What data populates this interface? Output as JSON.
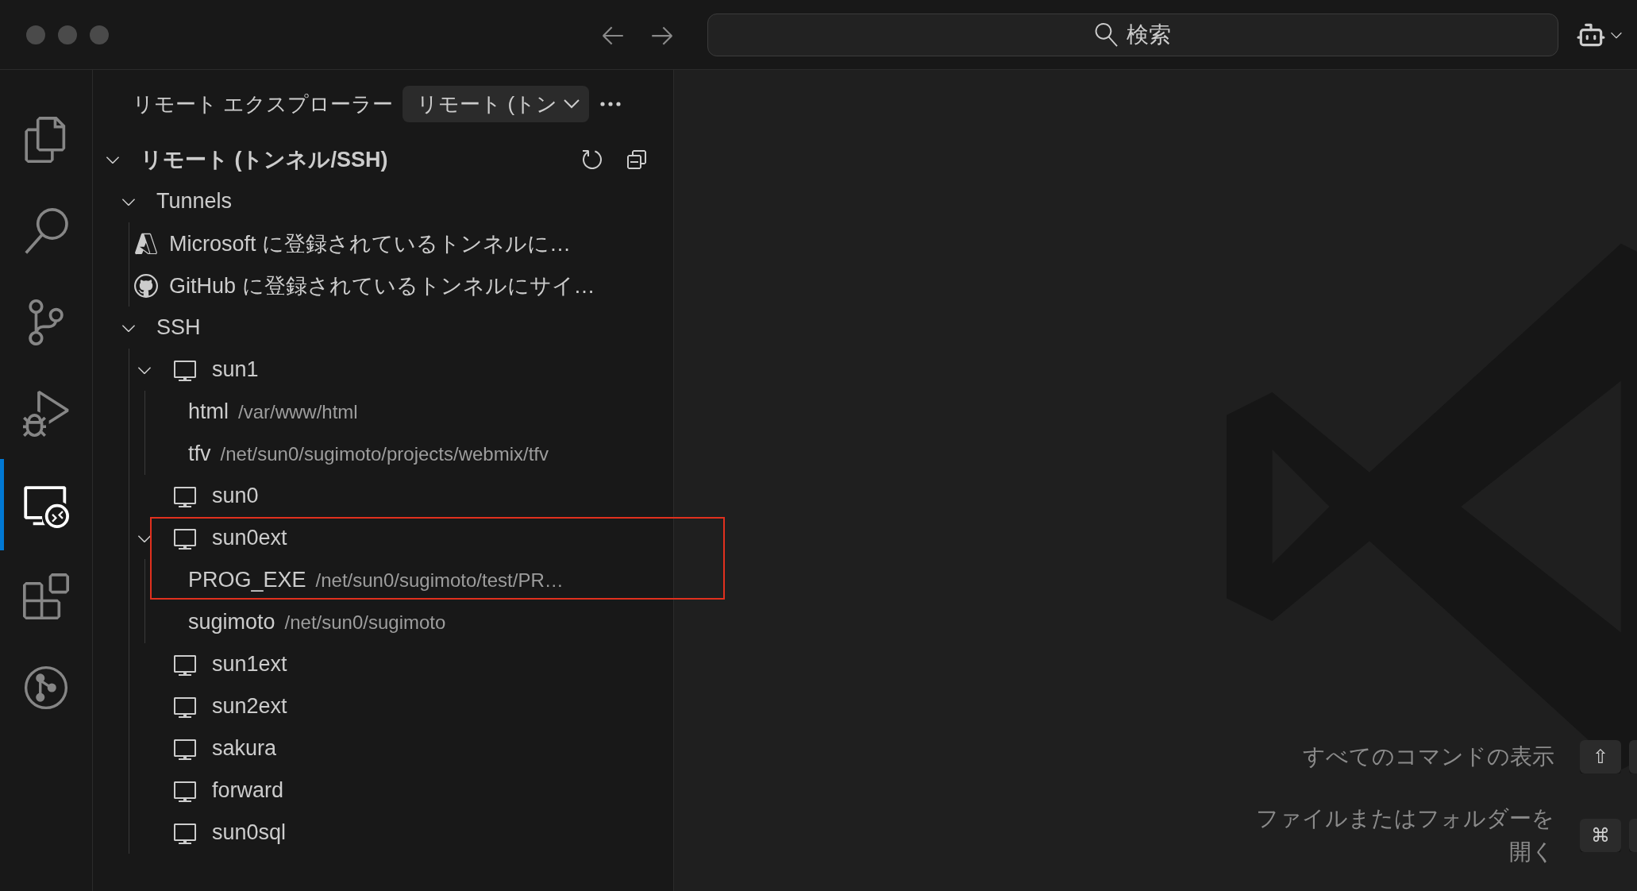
{
  "title_bar": {
    "search_label": "検索"
  },
  "activity_bar": [
    {
      "selected": false
    },
    {
      "selected": false
    },
    {
      "selected": false
    },
    {
      "selected": false
    },
    {
      "selected": true
    },
    {
      "selected": false
    },
    {
      "selected": false
    }
  ],
  "sidebar": {
    "title": "リモート エクスプローラー",
    "view_picker": "リモート (トン",
    "section": {
      "label": "リモート (トンネル/SSH)",
      "expanded": true,
      "children": [
        {
          "label": "Tunnels",
          "expanded": true,
          "children": [
            {
              "kind": "microsoft",
              "label": "Microsoft に登録されているトンネルに…"
            },
            {
              "kind": "github",
              "label": "GitHub に登録されているトンネルにサイ…"
            }
          ]
        },
        {
          "label": "SSH",
          "expanded": true,
          "children": [
            {
              "kind": "host",
              "label": "sun1",
              "expanded": true,
              "highlighted": false,
              "children": [
                {
                  "label": "html",
                  "path": "/var/www/html"
                },
                {
                  "label": "tfv",
                  "path": "/net/sun0/sugimoto/projects/webmix/tfv"
                }
              ]
            },
            {
              "kind": "host",
              "label": "sun0",
              "highlighted": false
            },
            {
              "kind": "host",
              "label": "sun0ext",
              "expanded": true,
              "highlighted": true,
              "children": [
                {
                  "label": "PROG_EXE",
                  "path": "/net/sun0/sugimoto/test/PR…"
                },
                {
                  "label": "sugimoto",
                  "path": "/net/sun0/sugimoto"
                }
              ]
            },
            {
              "kind": "host",
              "label": "sun1ext",
              "highlighted": false
            },
            {
              "kind": "host",
              "label": "sun2ext",
              "highlighted": false
            },
            {
              "kind": "host",
              "label": "sakura",
              "highlighted": false
            },
            {
              "kind": "host",
              "label": "forward",
              "highlighted": false
            },
            {
              "kind": "host",
              "label": "sun0sql",
              "highlighted": false
            }
          ]
        }
      ]
    }
  },
  "welcome": {
    "shortcuts": [
      {
        "label": "すべてのコマンドの表示",
        "key": "⇧"
      },
      {
        "label": "ファイルまたはフォルダーを開く",
        "key": "⌘"
      }
    ]
  }
}
